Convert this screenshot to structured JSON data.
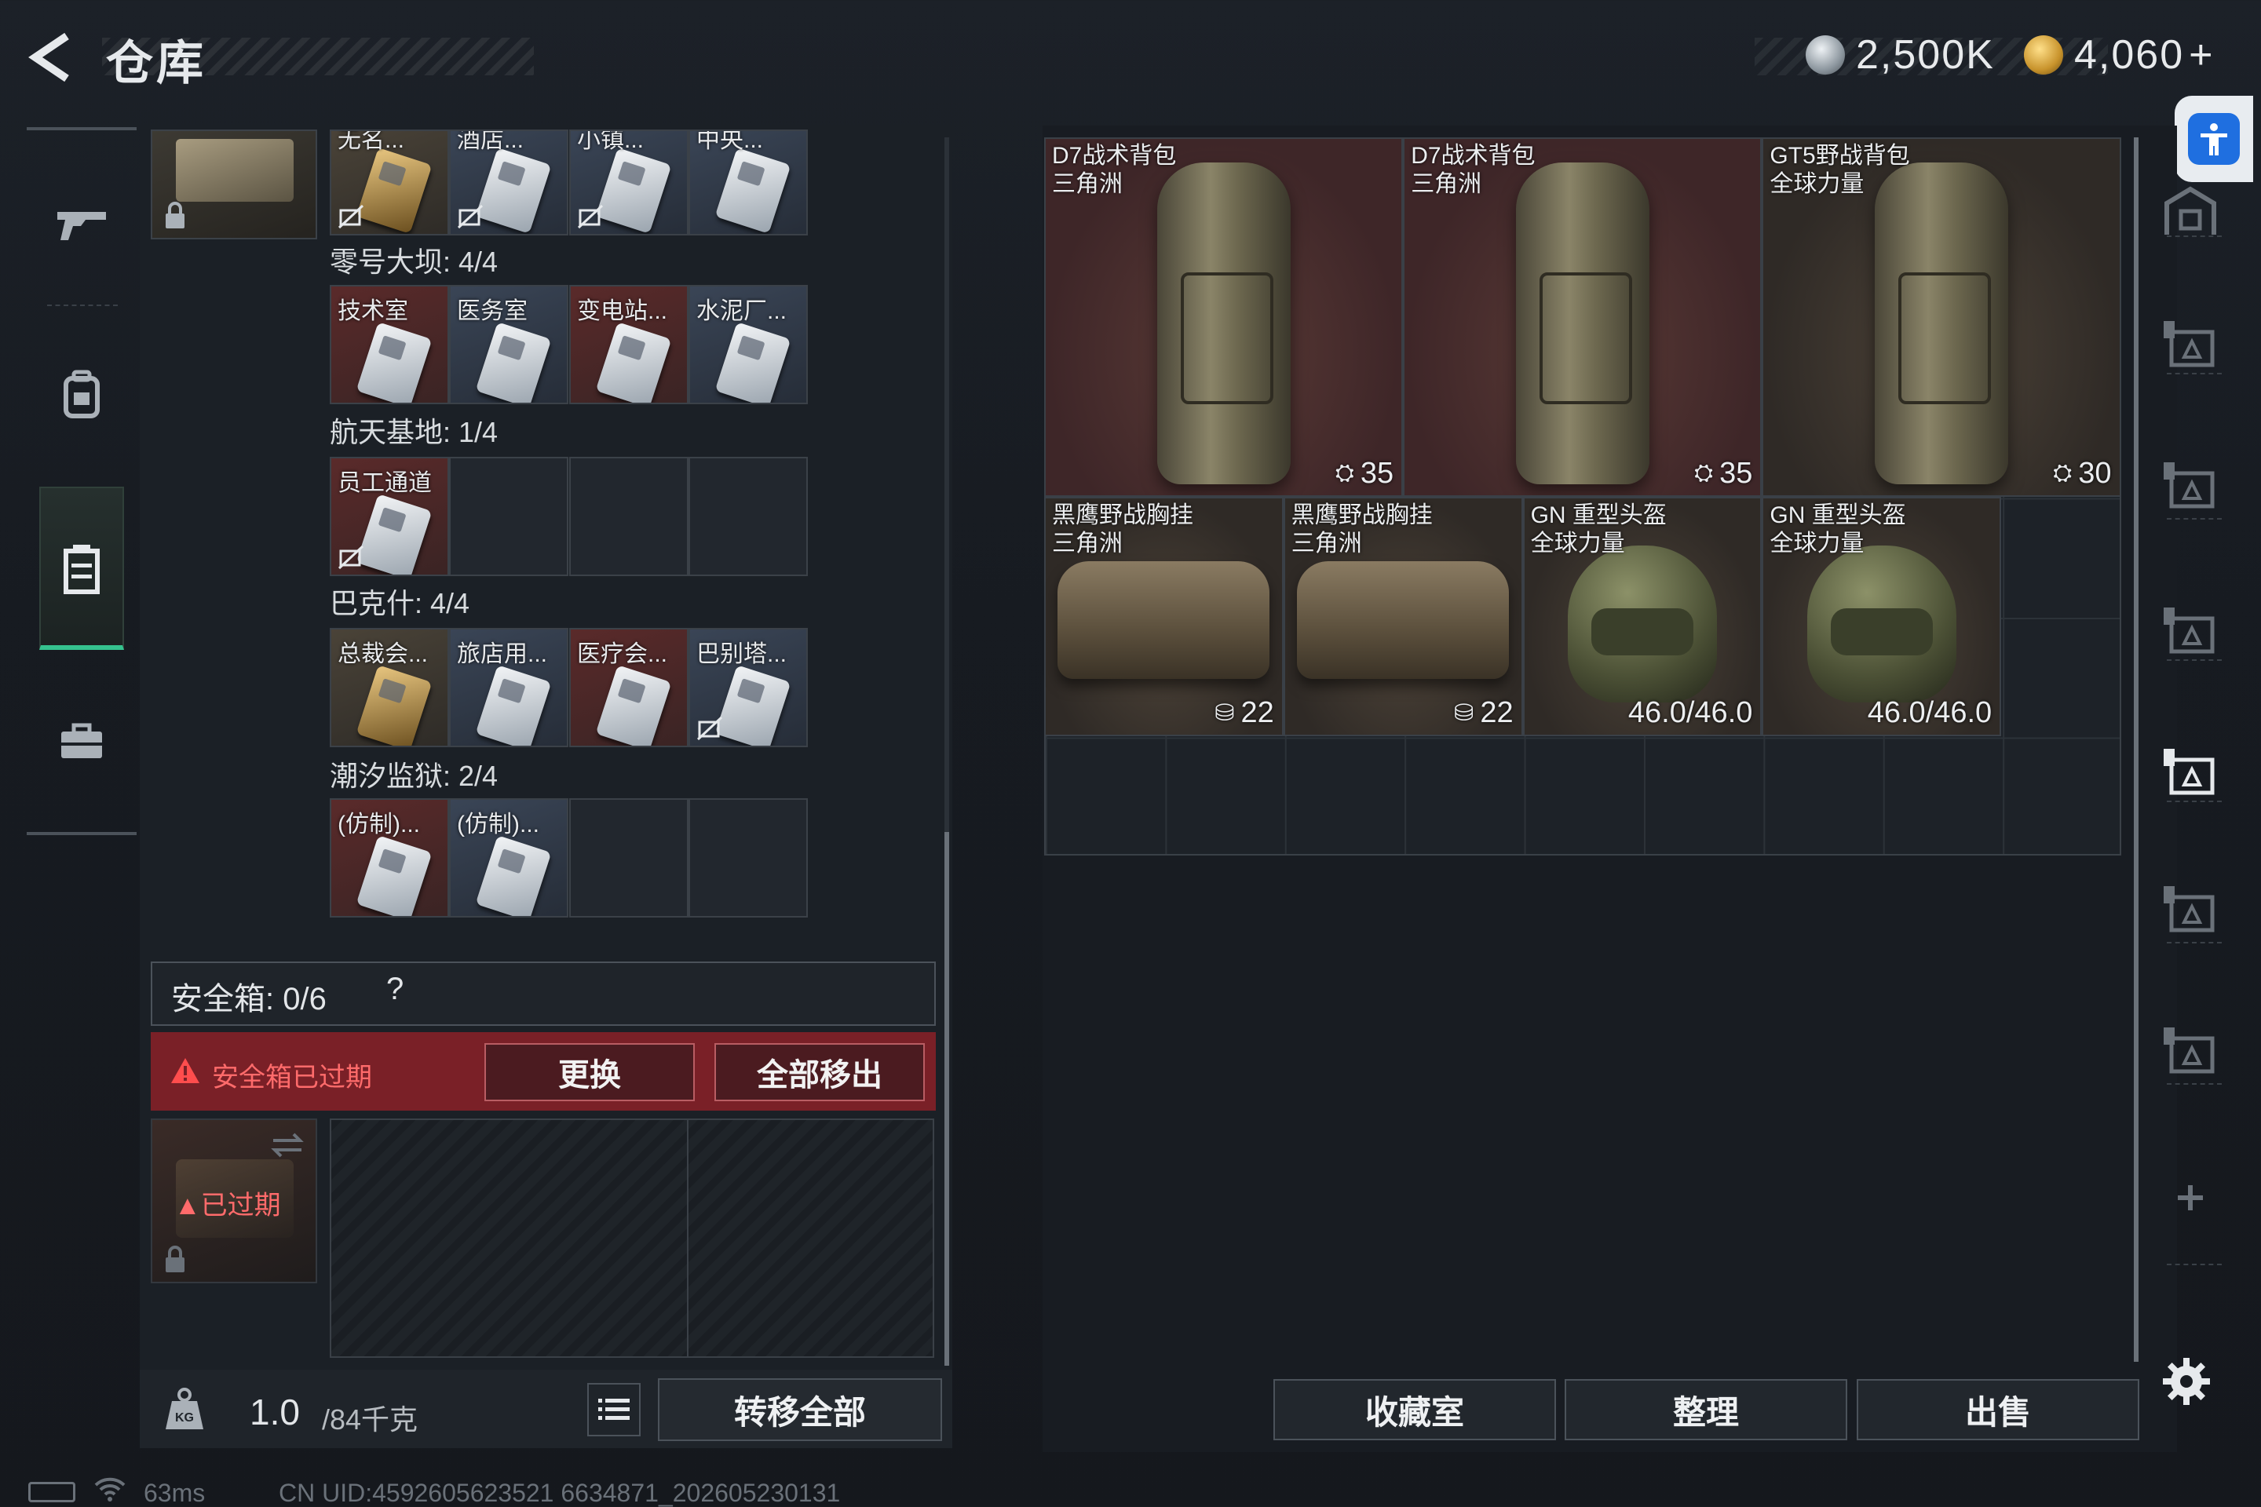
{
  "header": {
    "title": "仓库",
    "currency_silver": "2,500K",
    "currency_gold": "4,060",
    "currency_gold_add": "+"
  },
  "left_nav": {
    "items": [
      {
        "icon": "gun-icon"
      },
      {
        "icon": "backpack-icon"
      },
      {
        "icon": "storage-box-icon",
        "active": true
      },
      {
        "icon": "toolbox-icon"
      }
    ]
  },
  "keycard_groups": [
    {
      "title": "",
      "cards": [
        {
          "label": "无名...",
          "color": "gold"
        },
        {
          "label": "酒店...",
          "color": "grey"
        },
        {
          "label": "小镇...",
          "color": "grey"
        },
        {
          "label": "中央...",
          "color": "grey"
        }
      ]
    },
    {
      "title": "零号大坝: 4/4",
      "cards": [
        {
          "label": "技术室"
        },
        {
          "label": "医务室"
        },
        {
          "label": "变电站..."
        },
        {
          "label": "水泥厂..."
        }
      ]
    },
    {
      "title": "航天基地: 1/4",
      "cards": [
        {
          "label": "员工通道"
        }
      ]
    },
    {
      "title": "巴克什: 4/4",
      "cards": [
        {
          "label": "总裁会..."
        },
        {
          "label": "旅店用..."
        },
        {
          "label": "医疗会..."
        },
        {
          "label": "巴别塔..."
        }
      ]
    },
    {
      "title": "潮汐监狱: 2/4",
      "cards": [
        {
          "label": "(仿制)..."
        },
        {
          "label": "(仿制)..."
        }
      ]
    }
  ],
  "safe_box": {
    "label": "安全箱: 0/6",
    "help": "?",
    "expired_notice": "安全箱已过期",
    "replace_button": "更换",
    "remove_all_button": "全部移出",
    "expired_tag": "已过期"
  },
  "weight": {
    "current": "1.0",
    "max": "/84千克"
  },
  "transfer_all_button": "转移全部",
  "stash_items": [
    {
      "name_line1": "D7战术背包",
      "name_line2": "三角洲",
      "value": "35",
      "value_icon": "lock-icon",
      "kind": "backpack"
    },
    {
      "name_line1": "D7战术背包",
      "name_line2": "三角洲",
      "value": "35",
      "value_icon": "lock-icon",
      "kind": "backpack"
    },
    {
      "name_line1": "GT5野战背包",
      "name_line2": "全球力量",
      "value": "30",
      "value_icon": "lock-icon",
      "kind": "backpack"
    },
    {
      "name_line1": "黑鹰野战胸挂",
      "name_line2": "三角洲",
      "value": "22",
      "value_icon": "vest-icon",
      "kind": "vest"
    },
    {
      "name_line1": "黑鹰野战胸挂",
      "name_line2": "三角洲",
      "value": "22",
      "value_icon": "vest-icon",
      "kind": "vest"
    },
    {
      "name_line1": "GN 重型头盔",
      "name_line2": "全球力量",
      "value": "46.0/46.0",
      "kind": "helmet"
    },
    {
      "name_line1": "GN 重型头盔",
      "name_line2": "全球力量",
      "value": "46.0/46.0",
      "kind": "helmet"
    }
  ],
  "bottom_buttons": {
    "collection": "收藏室",
    "sort": "整理",
    "sell": "出售"
  },
  "right_rail": [
    "vault-icon",
    "rack-III-icon",
    "rack-III-icon",
    "rack-III-icon",
    "rack-III-icon",
    "rack-IV-icon",
    "rack-V-icon",
    "plus-icon"
  ],
  "status": {
    "ping": "63ms",
    "uid": "CN UID:4592605623521 6634871_202605230131"
  },
  "colors": {
    "accent_green": "#35c28e",
    "danger_red": "#ff6b6b",
    "expired_bg": "#7a2027"
  }
}
